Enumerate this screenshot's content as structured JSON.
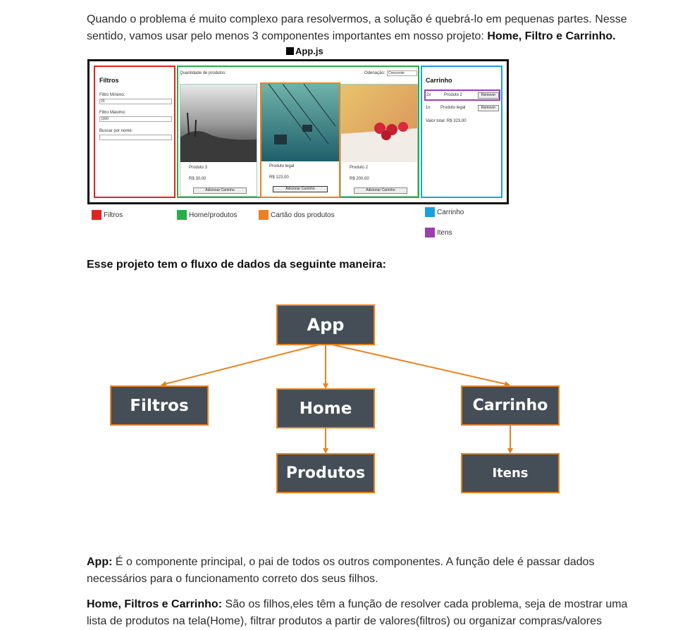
{
  "intro": {
    "text": "Quando o problema é muito complexo para resolvermos, a solução é quebrá-lo em pequenas partes. Nesse sentido, vamos usar pelo menos 3 componentes importantes em nosso projeto: ",
    "bold": "Home, Filtro e Carrinho."
  },
  "mockup": {
    "title": "App.js",
    "filters": {
      "heading": "Filtros",
      "min_label": "Filtro Mínimo:",
      "min_value": "20",
      "max_label": "Filtro Máximo:",
      "max_value": "1000",
      "search_label": "Buscar por nome:"
    },
    "home": {
      "quantity_label": "Quantidade de produtos:",
      "sort_label": "Odenação:",
      "sort_value": "Crescente",
      "products": [
        {
          "name": "Produto 3",
          "price": "R$ 30,00",
          "button": "Adicionar Carrinho"
        },
        {
          "name": "Produto legal",
          "price": "R$ 123,00",
          "button": "Adicionar Carrinho"
        },
        {
          "name": "Produto 2",
          "price": "R$ 200,00",
          "button": "Adicionar Carrinho"
        }
      ]
    },
    "cart": {
      "heading": "Carrinho",
      "items": [
        {
          "qty": "2x",
          "name": "Produto 2",
          "button": "Remover"
        },
        {
          "qty": "1x",
          "name": "Produto legal",
          "button": "Remover"
        }
      ],
      "total": "Valor total: R$ 323,00"
    },
    "legend": [
      {
        "label": "Filtros",
        "color": "#e32121"
      },
      {
        "label": "Home/produtos",
        "color": "#22b04a"
      },
      {
        "label": "Cartão dos produtos",
        "color": "#f07f1e"
      },
      {
        "label": "Carrinho",
        "color": "#1aa0e0"
      },
      {
        "label": "Itens",
        "color": "#9b3fae"
      }
    ]
  },
  "flow_heading": "Esse projeto tem o fluxo de dados da seguinte maneira:",
  "diagram": {
    "nodes": {
      "app": "App",
      "filtros": "Filtros",
      "home": "Home",
      "carrinho": "Carrinho",
      "produtos": "Produtos",
      "itens": "Itens"
    },
    "colors": {
      "node_fill": "#454e56",
      "border": "#e8811f",
      "arrow": "#e8811f"
    }
  },
  "app_paragraph": {
    "bold": "App:",
    "text": " É o componente principal, o pai de todos os outros componentes. A função dele é passar dados necessários para o funcionamento correto dos seus filhos."
  },
  "children_paragraph": {
    "bold": "Home, Filtros e Carrinho:",
    "text": " São os filhos,eles têm a função de resolver cada problema, seja de mostrar uma lista de produtos na tela(Home), filtrar produtos a partir de valores(filtros) ou organizar compras/valores"
  }
}
